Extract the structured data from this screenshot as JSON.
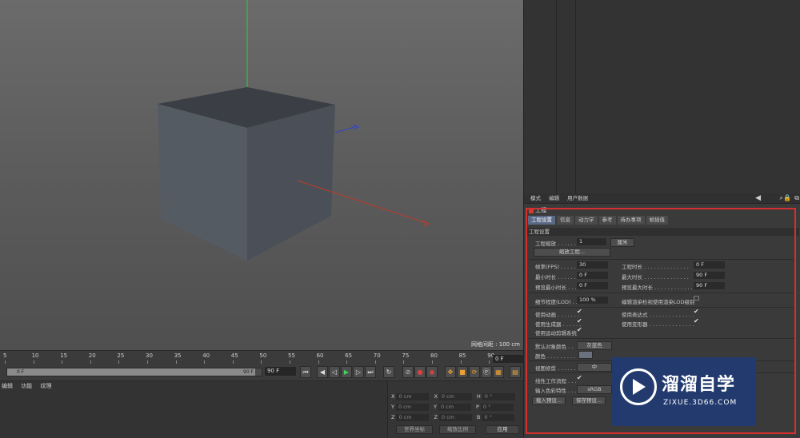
{
  "viewport": {
    "grid_spacing": "网格间距 : 100 cm",
    "colors": {
      "bg_top": "#6b6b6b",
      "bg_bottom": "#4f4f4f",
      "cube_front": "#545a62",
      "cube_side": "#4a4f57",
      "cube_top": "#3a3e44",
      "axis_x": "#c0392b",
      "axis_y": "#2ecc40",
      "axis_z": "#3344cc"
    }
  },
  "timeline": {
    "ticks": [
      "5",
      "10",
      "15",
      "20",
      "25",
      "30",
      "35",
      "40",
      "45",
      "50",
      "55",
      "60",
      "65",
      "70",
      "75",
      "80",
      "85",
      "90"
    ],
    "current_frame": "0 F",
    "scrub_start": "0 F",
    "scrub_end": "90 F",
    "end_frame": "90 F",
    "transport_icons": [
      "go-start-icon",
      "prev-key-icon",
      "play-back-icon",
      "play-icon",
      "next-key-icon",
      "go-end-icon",
      "loop-icon"
    ],
    "record_icons": [
      "no-entry-icon",
      "record-icon",
      "autokey-icon",
      "move-icon",
      "scale-icon",
      "rotate-icon",
      "param-icon",
      "film-icon"
    ]
  },
  "material_panel": {
    "menu": [
      "编辑",
      "功能",
      "纹理"
    ]
  },
  "coordinates": {
    "rows": [
      {
        "a": "X",
        "av": "0 cm",
        "b": "X",
        "bv": "0 cm",
        "c": "H",
        "cv": "0 °"
      },
      {
        "a": "Y",
        "av": "0 cm",
        "b": "Y",
        "bv": "0 cm",
        "c": "P",
        "cv": "0 °"
      },
      {
        "a": "Z",
        "av": "0 cm",
        "b": "Z",
        "bv": "0 cm",
        "c": "B",
        "cv": "0 °"
      }
    ],
    "world_label": "世界坐标",
    "scale_label": "缩放比例",
    "apply_label": "应用"
  },
  "attributes": {
    "menu": [
      "模式",
      "编辑",
      "用户数据"
    ],
    "object_title": "工程",
    "tabs": [
      "工程设置",
      "信息",
      "动力学",
      "参考",
      "待办事项",
      "帧插值"
    ],
    "section_title": "工程设置",
    "project_scale_label": "工程缩放 . . . . . .",
    "project_scale_value": "1",
    "project_scale_unit": "厘米",
    "scale_project_btn": "缩放工程...",
    "fps_label": "帧率(FPS) . . . . . .",
    "fps_value": "30",
    "project_time_label": "工程时长 . . . . . . . . . . . . . .",
    "project_time_value": "0 F",
    "min_time_label": "最小时长 . . . . . .",
    "min_time_value": "0 F",
    "max_time_label": "最大时长 . . . . . . . . . . . . . .",
    "max_time_value": "90 F",
    "preview_min_label": "预览最小时长 . . .",
    "preview_min_value": "0 F",
    "preview_max_label": "预览最大时长 . . . . . . . . . . . .",
    "preview_max_value": "90 F",
    "lod_label": "细节程度(LOD) . . .",
    "lod_value": "100 %",
    "render_lod_label": "编辑渲染检视使用渲染LOD级别",
    "use_animation": "使用动画 . . . . . . .",
    "use_expression": "使用表达式 . . . . . . . . . . . . . .",
    "use_generator": "使用生成器 . . . . . .",
    "use_deformer": "使用变形器 . . . . . . . . . . . . . .",
    "use_motion_system": "使用运动剪辑系统",
    "default_color_label": "默认对象颜色 . .",
    "default_color_value": "灰蓝色",
    "color_label": "颜色 . . . . . . . . .",
    "view_clipping_label": "视图修剪 . . . . . .",
    "view_clipping_value": "中",
    "linear_workflow_label": "线性工作流程 . . .",
    "input_color_label": "输入色彩特性 . . .",
    "input_color_value": "sRGB",
    "load_preset_btn": "载入预设...",
    "save_preset_btn": "保存预设...",
    "frame_color": "#d62f2f"
  },
  "watermark": {
    "brand": "溜溜自学",
    "url": "ZIXUE.3D66.COM",
    "bg_color": "#223a6e"
  }
}
